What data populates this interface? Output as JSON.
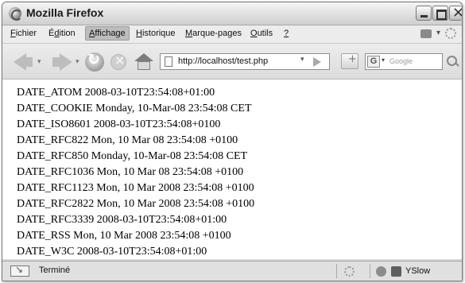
{
  "window": {
    "title": "Mozilla Firefox"
  },
  "menu": {
    "items": [
      {
        "pre": "",
        "acc": "F",
        "post": "ichier"
      },
      {
        "pre": "É",
        "acc": "d",
        "post": "ition"
      },
      {
        "pre": "",
        "acc": "A",
        "post": "ffichage"
      },
      {
        "pre": "",
        "acc": "H",
        "post": "istorique"
      },
      {
        "pre": "",
        "acc": "M",
        "post": "arque-pages"
      },
      {
        "pre": "",
        "acc": "O",
        "post": "utils"
      },
      {
        "pre": "",
        "acc": "?",
        "post": ""
      }
    ]
  },
  "navigation": {
    "url": "http://localhost/test.php",
    "search_placeholder": "Google",
    "search_engine_letter": "G"
  },
  "content": {
    "lines": [
      "DATE_ATOM 2008-03-10T23:54:08+01:00",
      "DATE_COOKIE Monday, 10-Mar-08 23:54:08 CET",
      "DATE_ISO8601 2008-03-10T23:54:08+0100",
      "DATE_RFC822 Mon, 10 Mar 08 23:54:08 +0100",
      "DATE_RFC850 Monday, 10-Mar-08 23:54:08 CET",
      "DATE_RFC1036 Mon, 10 Mar 08 23:54:08 +0100",
      "DATE_RFC1123 Mon, 10 Mar 2008 23:54:08 +0100",
      "DATE_RFC2822 Mon, 10 Mar 2008 23:54:08 +0100",
      "DATE_RFC3339 2008-03-10T23:54:08+01:00",
      "DATE_RSS Mon, 10 Mar 2008 23:54:08 +0100",
      "DATE_W3C 2008-03-10T23:54:08+01:00"
    ]
  },
  "status": {
    "text": "Terminé",
    "yslow": "YSlow"
  }
}
